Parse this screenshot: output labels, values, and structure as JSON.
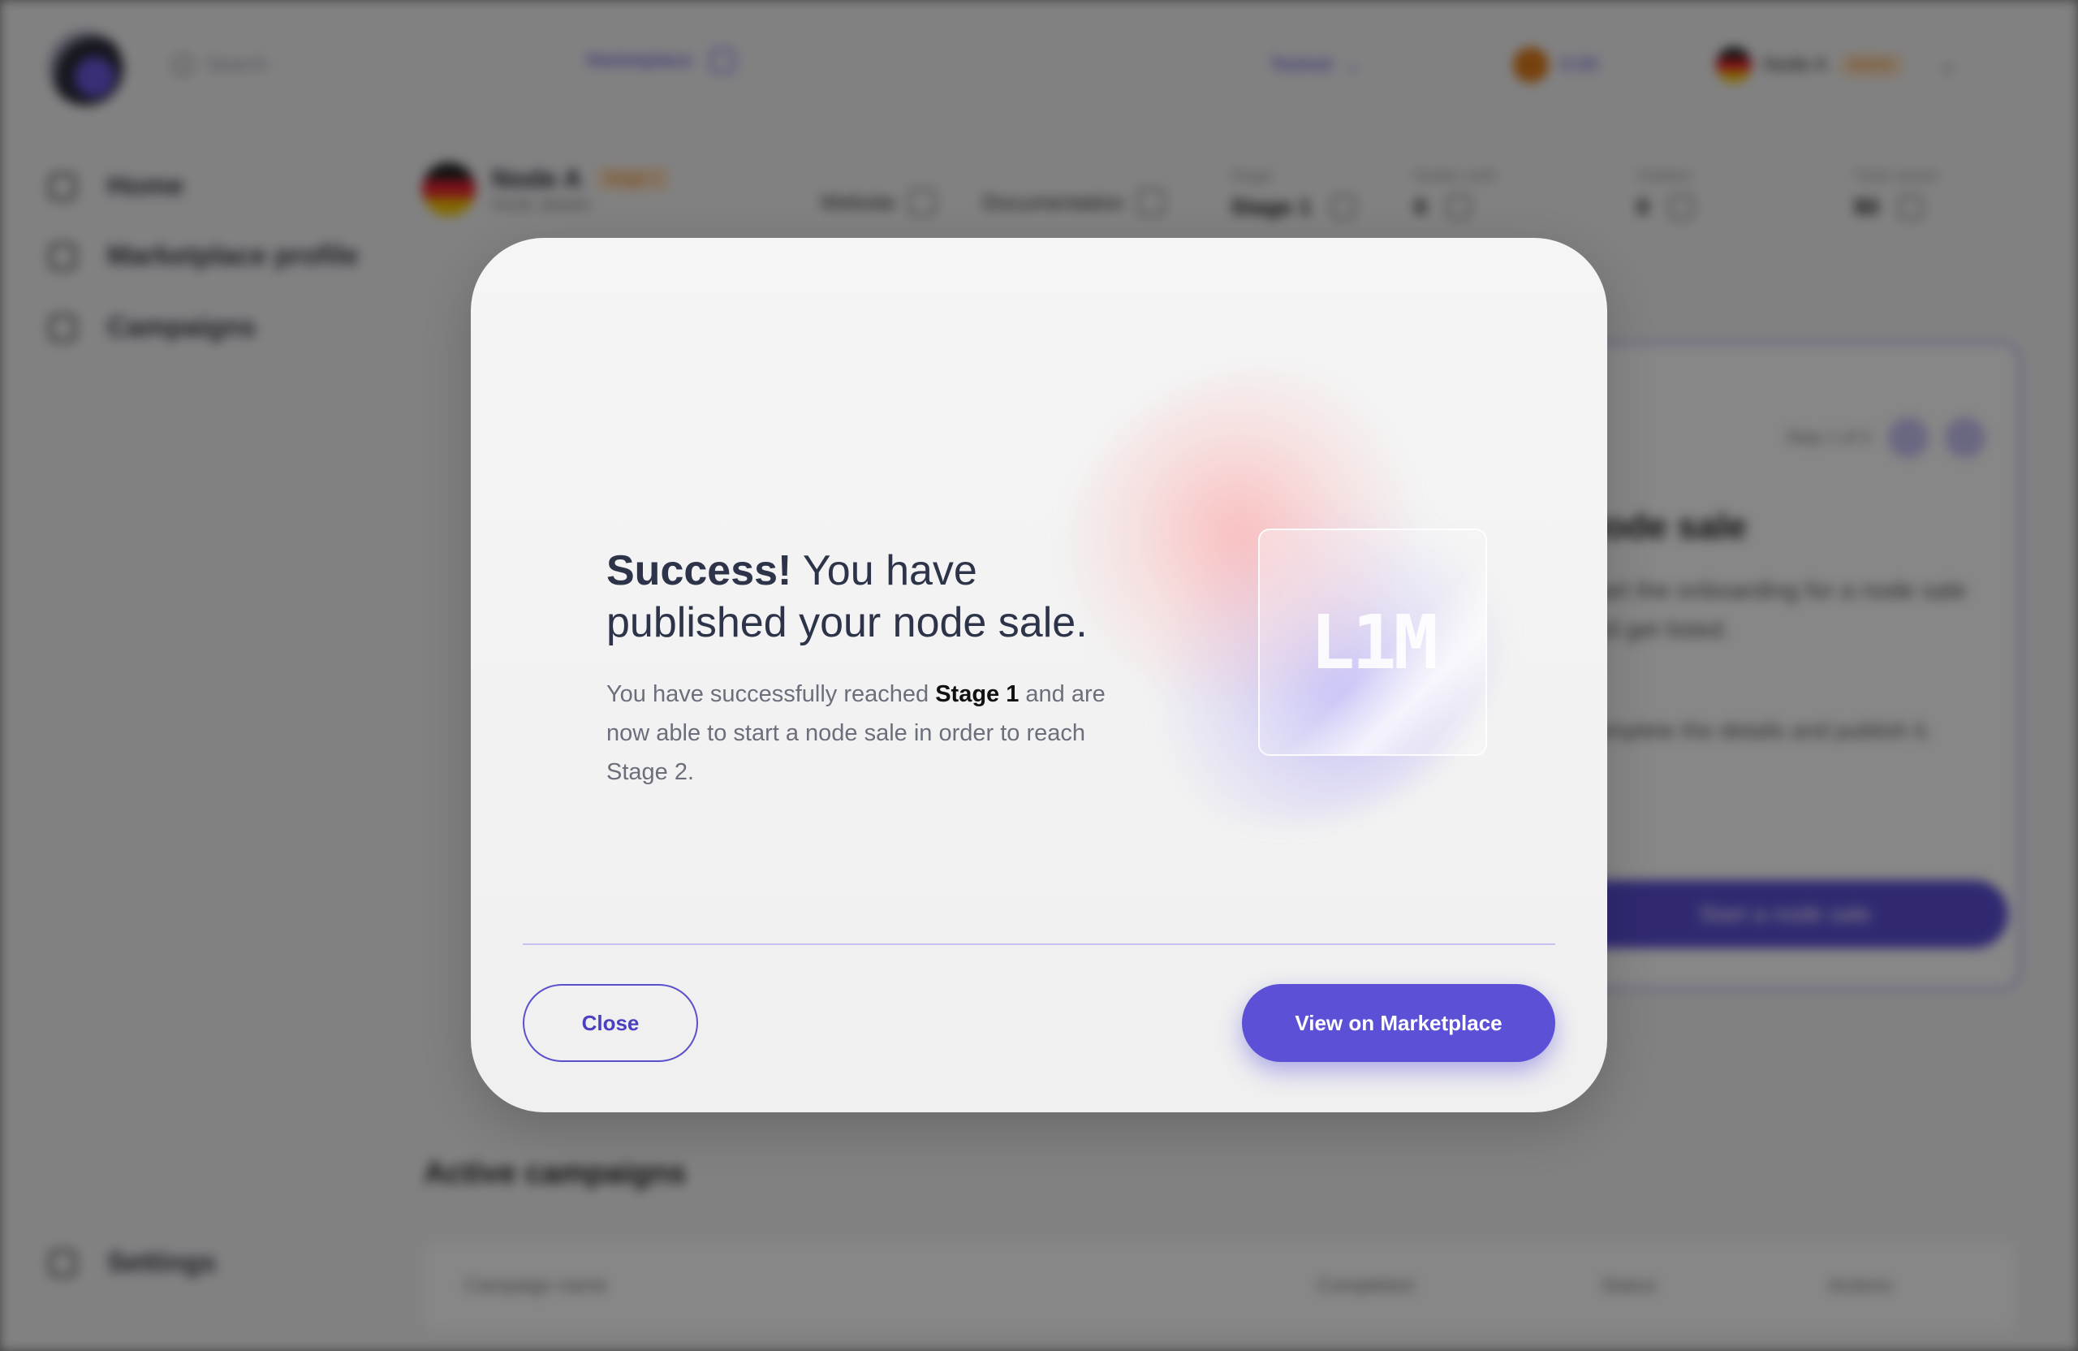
{
  "background": {
    "header": {
      "search_placeholder": "Search",
      "nav_link": "Marketplace",
      "network_selector": "Testnet",
      "balance": "0.00",
      "account_name": "Node A",
      "account_tag": "Admin"
    },
    "sidebar": {
      "items": [
        {
          "label": "Home",
          "icon": "home-icon"
        },
        {
          "label": "Marketplace profile",
          "icon": "profile-icon"
        },
        {
          "label": "Campaigns",
          "icon": "campaigns-icon"
        }
      ],
      "settings_label": "Settings"
    },
    "subheader": {
      "name": "Node A",
      "tag": "Stage 1",
      "subtitle": "Node details",
      "links": [
        "Website",
        "Documentation"
      ],
      "stats": [
        {
          "label": "Stage",
          "value": "Stage 1"
        },
        {
          "label": "Nodes sold",
          "value": "0"
        },
        {
          "label": "Holders",
          "value": "0"
        },
        {
          "label": "Total raised",
          "value": "$0"
        }
      ]
    },
    "card": {
      "pager": "Step 1 of 2",
      "title": "Node sale",
      "text": "Start the onboarding for a node sale and get listed.",
      "text2": "Complete the details and publish it.",
      "button": "Start a node sale"
    },
    "campaigns": {
      "title": "Active campaigns",
      "columns": [
        "Campaign name",
        "Completion",
        "Status",
        "Actions"
      ]
    }
  },
  "modal": {
    "title_bold": "Success!",
    "title_rest": " You have published your node sale.",
    "body_before": "You have successfully reached ",
    "body_bold": "Stage 1",
    "body_after": " and are now able to start a node sale in order to reach Stage 2.",
    "token_label": "L1M",
    "close_label": "Close",
    "primary_label": "View on Marketplace",
    "accent_color": "#5c51d6"
  }
}
